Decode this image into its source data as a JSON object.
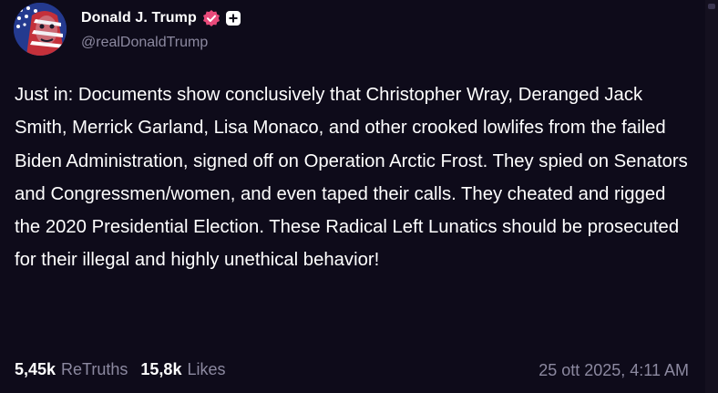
{
  "author": {
    "display_name": "Donald J. Trump",
    "handle": "@realDonaldTrump",
    "avatar_icon": "flag-face-avatar",
    "verified_icon": "verified-badge-icon",
    "plus_icon": "plus-badge-icon",
    "verified_color": "#e84a7a"
  },
  "post": {
    "text": "Just in: Documents show conclusively that Christopher Wray, Deranged Jack Smith, Merrick Garland, Lisa Monaco, and other crooked lowlifes from the failed Biden Administration, signed off on Operation Arctic Frost. They spied on Senators and Congressmen/women, and even taped their calls. They cheated and rigged the 2020 Presidential Election. These Radical Left Lunatics should be prosecuted for their illegal and highly unethical behavior!",
    "retruths_count": "5,45k",
    "retruths_label": "ReTruths",
    "likes_count": "15,8k",
    "likes_label": "Likes",
    "timestamp": "25 ott 2025, 4:11 AM"
  },
  "colors": {
    "background": "#0e0b1a",
    "text_primary": "#ffffff",
    "text_secondary": "#8c89a0"
  }
}
